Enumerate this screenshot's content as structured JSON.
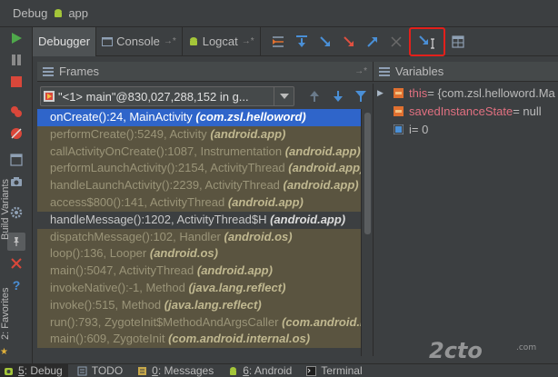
{
  "title": {
    "label": "Debug",
    "app": "app"
  },
  "tabs": [
    {
      "label": "Debugger"
    },
    {
      "label": "Console"
    },
    {
      "label": "Logcat"
    }
  ],
  "left_labels": {
    "build_variants": "Build Variants",
    "favorites": "2: Favorites"
  },
  "frames": {
    "header": "Frames",
    "thread": "\"<1> main\"@830,027,288,152 in g...",
    "items": [
      {
        "name": "onCreate():24, MainActivity",
        "pkg": "(com.zsl.helloword)",
        "kind": "sel"
      },
      {
        "name": "performCreate():5249, Activity",
        "pkg": "(android.app)",
        "kind": "lib"
      },
      {
        "name": "callActivityOnCreate():1087, Instrumentation",
        "pkg": "(android.app)",
        "kind": "lib"
      },
      {
        "name": "performLaunchActivity():2154, ActivityThread",
        "pkg": "(android.app)",
        "kind": "lib"
      },
      {
        "name": "handleLaunchActivity():2239, ActivityThread",
        "pkg": "(android.app)",
        "kind": "lib"
      },
      {
        "name": "access$800():141, ActivityThread",
        "pkg": "(android.app)",
        "kind": "lib"
      },
      {
        "name": "handleMessage():1202, ActivityThread$H",
        "pkg": "(android.app)",
        "kind": "app"
      },
      {
        "name": "dispatchMessage():102, Handler",
        "pkg": "(android.os)",
        "kind": "lib"
      },
      {
        "name": "loop():136, Looper",
        "pkg": "(android.os)",
        "kind": "lib"
      },
      {
        "name": "main():5047, ActivityThread",
        "pkg": "(android.app)",
        "kind": "lib"
      },
      {
        "name": "invokeNative():-1, Method",
        "pkg": "(java.lang.reflect)",
        "kind": "lib"
      },
      {
        "name": "invoke():515, Method",
        "pkg": "(java.lang.reflect)",
        "kind": "lib"
      },
      {
        "name": "run():793, ZygoteInit$MethodAndArgsCaller",
        "pkg": "(com.android.i",
        "kind": "lib"
      },
      {
        "name": "main():609, ZygoteInit",
        "pkg": "(com.android.internal.os)",
        "kind": "lib"
      }
    ]
  },
  "variables": {
    "header": "Variables",
    "items": [
      {
        "name": "this",
        "value": " = {com.zsl.helloword.Ma",
        "expandable": true,
        "icon": "object",
        "plain": false
      },
      {
        "name": "savedInstanceState",
        "value": " = null",
        "expandable": false,
        "icon": "object",
        "plain": false
      },
      {
        "name": "i",
        "value": " = 0",
        "expandable": false,
        "icon": "primitive",
        "plain": true
      }
    ]
  },
  "status_tabs": [
    {
      "num": "5",
      "label": ": Debug",
      "icon": "debug-icon"
    },
    {
      "num": "",
      "label": "TODO",
      "icon": "todo-icon"
    },
    {
      "num": "0",
      "label": ": Messages",
      "icon": "messages-icon"
    },
    {
      "num": "6",
      "label": ": Android",
      "icon": "android-icon"
    },
    {
      "num": "",
      "label": "Terminal",
      "icon": "terminal-icon"
    }
  ],
  "watermark": {
    "main": "2cto",
    "sub": ".com"
  },
  "colors": {
    "selection": "#2f65ca",
    "library_row": "#5a5440",
    "highlight": "#e3201b",
    "android_green": "#a4c639"
  }
}
